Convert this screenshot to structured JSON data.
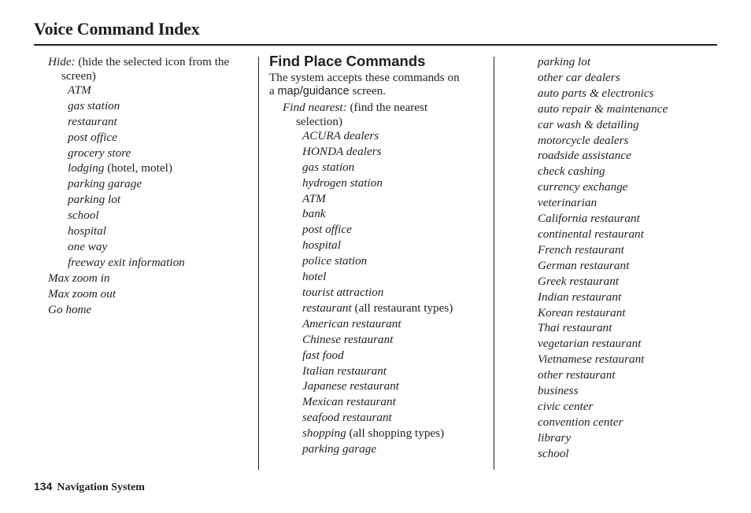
{
  "header": {
    "title": "Voice Command Index"
  },
  "column1": {
    "hide": {
      "label": "Hide:",
      "desc": " (hide the selected icon from the",
      "desc_cont": "screen)"
    },
    "hide_items": [
      {
        "text": "ATM",
        "note": ""
      },
      {
        "text": "gas station",
        "note": ""
      },
      {
        "text": "restaurant",
        "note": ""
      },
      {
        "text": "post office",
        "note": ""
      },
      {
        "text": "grocery store",
        "note": ""
      },
      {
        "text": "lodging",
        "note": " (hotel, motel)"
      },
      {
        "text": "parking garage",
        "note": ""
      },
      {
        "text": "parking lot",
        "note": ""
      },
      {
        "text": "school",
        "note": ""
      },
      {
        "text": "hospital",
        "note": ""
      },
      {
        "text": "one way",
        "note": ""
      },
      {
        "text": "freeway exit information",
        "note": ""
      }
    ],
    "commands": [
      "Max zoom in",
      "Max zoom out",
      "Go home"
    ]
  },
  "column2": {
    "heading": "Find Place Commands",
    "intro_line1": "The system accepts these commands on",
    "intro_a": "a ",
    "intro_screen": "map/guidance",
    "intro_end": " screen.",
    "find_nearest": {
      "label": "Find nearest:",
      "desc": " (find the nearest",
      "desc_cont": "selection)"
    },
    "items": [
      {
        "text": "ACURA dealers",
        "note": ""
      },
      {
        "text": "HONDA dealers",
        "note": ""
      },
      {
        "text": "gas station",
        "note": ""
      },
      {
        "text": "hydrogen station",
        "note": ""
      },
      {
        "text": "ATM",
        "note": ""
      },
      {
        "text": "bank",
        "note": ""
      },
      {
        "text": "post office",
        "note": ""
      },
      {
        "text": "hospital",
        "note": ""
      },
      {
        "text": "police station",
        "note": ""
      },
      {
        "text": "hotel",
        "note": ""
      },
      {
        "text": "tourist attraction",
        "note": ""
      },
      {
        "text": "restaurant",
        "note": " (all restaurant types)"
      },
      {
        "text": "American restaurant",
        "note": ""
      },
      {
        "text": "Chinese restaurant",
        "note": ""
      },
      {
        "text": "fast food",
        "note": ""
      },
      {
        "text": "Italian restaurant",
        "note": ""
      },
      {
        "text": "Japanese restaurant",
        "note": ""
      },
      {
        "text": "Mexican restaurant",
        "note": ""
      },
      {
        "text": "seafood restaurant",
        "note": ""
      },
      {
        "text": "shopping",
        "note": " (all shopping types)"
      },
      {
        "text": "parking garage",
        "note": ""
      }
    ]
  },
  "column3": {
    "items": [
      "parking lot",
      "other car dealers",
      "auto parts & electronics",
      "auto repair & maintenance",
      "car wash & detailing",
      "motorcycle dealers",
      "roadside assistance",
      "check cashing",
      "currency exchange",
      "veterinarian",
      "California restaurant",
      "continental restaurant",
      "French restaurant",
      "German restaurant",
      "Greek restaurant",
      "Indian restaurant",
      "Korean restaurant",
      "Thai restaurant",
      "vegetarian restaurant",
      "Vietnamese restaurant",
      "other restaurant",
      "business",
      "civic center",
      "convention center",
      "library",
      "school"
    ]
  },
  "footer": {
    "page_number": "134",
    "section": "Navigation System"
  }
}
